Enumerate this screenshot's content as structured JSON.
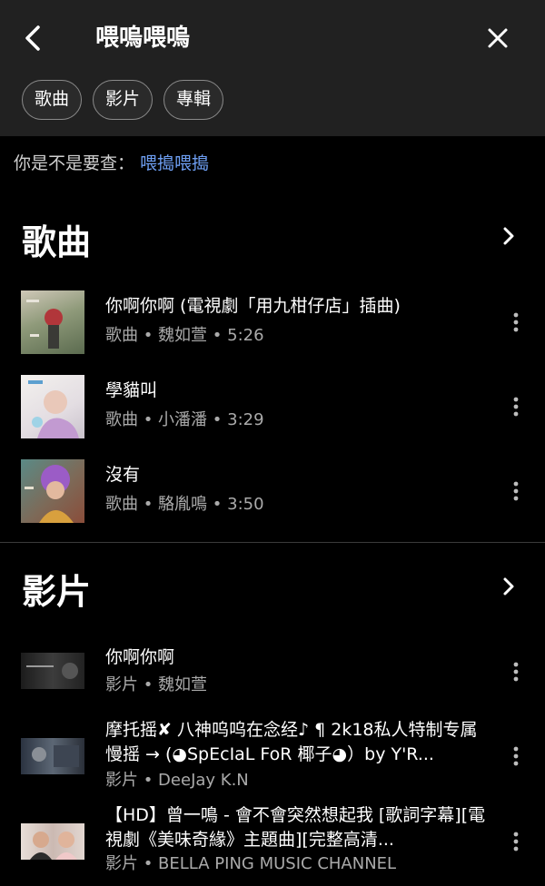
{
  "header": {
    "query": "喂嗚喂嗚",
    "back_icon": "back-arrow-icon",
    "close_icon": "close-icon"
  },
  "chips": [
    "歌曲",
    "影片",
    "專輯"
  ],
  "suggestion": {
    "prefix": "你是不是要查：",
    "link": "喂搗喂搗"
  },
  "songs_section": {
    "title": "歌曲",
    "items": [
      {
        "title": "你啊你啊 (電視劇「用九柑仔店」插曲)",
        "subtitle": "歌曲 • 魏如萱 • 5:26"
      },
      {
        "title": "學貓叫",
        "subtitle": "歌曲 • 小潘潘 • 3:29"
      },
      {
        "title": "沒有",
        "subtitle": "歌曲 • 駱胤鳴 • 3:50"
      }
    ]
  },
  "videos_section": {
    "title": "影片",
    "items": [
      {
        "title": "你啊你啊",
        "subtitle": "影片 • 魏如萱"
      },
      {
        "title": "摩托摇✘ 八神呜呜在念经♪ ¶ 2k18私人特制专属慢摇 → (◕SpEcIaL FoR 椰子◕）by Y'R...",
        "subtitle": "影片 • DeeJay K.N"
      },
      {
        "title": "【HD】曾一鳴 - 會不會突然想起我 [歌詞字幕][電視劇《美味奇緣》主題曲][完整高清...",
        "subtitle": "影片 • BELLA PING MUSIC CHANNEL"
      }
    ]
  },
  "colors": {
    "background": "#000000",
    "header_bg": "#212121",
    "link": "#6e9ff3",
    "secondary_text": "#aaaaaa"
  }
}
